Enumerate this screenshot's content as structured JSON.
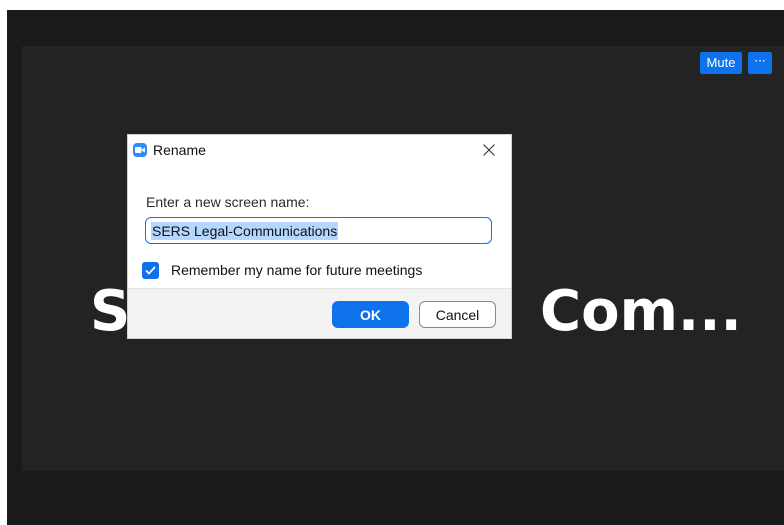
{
  "participant": {
    "name_left": "SE",
    "name_right": "Com..."
  },
  "controls": {
    "mute_label": "Mute",
    "more_label": "···",
    "more_icon": "more-icon"
  },
  "dialog": {
    "title": "Rename",
    "app_icon": "zoom-camera-icon",
    "close_icon": "close-icon",
    "prompt": "Enter a new screen name:",
    "input_value": "SERS Legal-Communications",
    "remember_label": "Remember my name for future meetings",
    "remember_checked": true,
    "ok_label": "OK",
    "cancel_label": "Cancel"
  },
  "colors": {
    "accent": "#0e72ed",
    "background": "#1a1a1a",
    "video_tile": "#232323",
    "selection": "#b4d7ff"
  }
}
